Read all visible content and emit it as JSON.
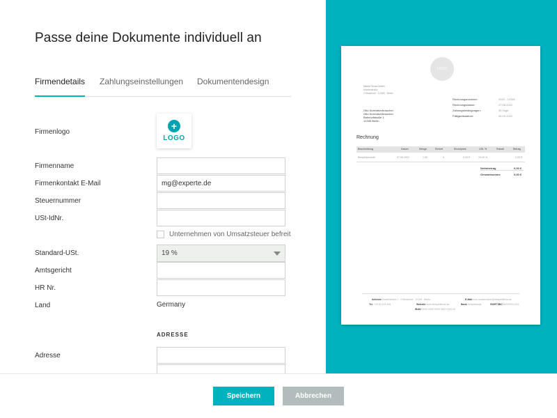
{
  "page": {
    "title": "Passe deine Dokumente individuell an"
  },
  "tabs": [
    {
      "label": "Firmendetails",
      "active": true
    },
    {
      "label": "Zahlungseinstellungen",
      "active": false
    },
    {
      "label": "Dokumentendesign",
      "active": false
    }
  ],
  "form": {
    "logo_label": "Firmenlogo",
    "logo_button": "LOGO",
    "company_name_label": "Firmenname",
    "company_name_value": "",
    "email_label": "Firmenkontakt E-Mail",
    "email_value": "mg@experte.de",
    "tax_number_label": "Steuernummer",
    "tax_number_value": "",
    "vat_id_label": "USt-IdNr.",
    "vat_id_value": "",
    "vat_exempt_label": "Unternehmen von Umsatzsteuer befreit",
    "vat_exempt_checked": false,
    "standard_vat_label": "Standard-USt.",
    "standard_vat_value": "19 %",
    "court_label": "Amtsgericht",
    "court_value": "",
    "hr_label": "HR Nr.",
    "hr_value": "",
    "country_label": "Land",
    "country_value": "Germany",
    "address_section": "ADRESSE",
    "address_label": "Adresse",
    "address_value": ""
  },
  "preview": {
    "logo_text": "LOGO",
    "sender_name": "Meine Firma GmbH",
    "sender_line2": "Musterstraße",
    "sender_line3": "0 Musterort · 12345 · Berlin",
    "recipient_lines": [
      "Otto Normalverbraucher",
      "Otto Normalverbraucher",
      "Bahnhofstraße 1",
      "12345 Berlin"
    ],
    "meta": [
      {
        "label": "Rechnungsnummer:",
        "value": "2022 - 12345"
      },
      {
        "label": "Rechnungsdatum:",
        "value": "27.08.2022"
      },
      {
        "label": "Zahlungsbedingungen:",
        "value": "30 Tage"
      },
      {
        "label": "Fälligkeitsdatum:",
        "value": "26.09.2022"
      }
    ],
    "heading": "Rechnung",
    "table_headers": [
      "Beschreibung",
      "Datum",
      "Menge",
      "Einheit",
      "Einzelpreis",
      "USt. %",
      "Rabatt",
      "Betrag"
    ],
    "table_row": [
      "Beispielprodukt",
      "27.08.2022",
      "1,00",
      "h",
      "0,00 €",
      "19,00 %",
      "",
      "0,00 €"
    ],
    "net_label": "Nettobetrag",
    "net_value": "0,00 €",
    "total_label": "Gesamtsumme",
    "total_value": "0,00 €",
    "footer_line1_label": "Adresse",
    "footer_line1_value": "Musterstraße 1 · 0 Musterort · 12345 · Berlin",
    "footer_email_label": "E-Mail",
    "footer_email_value": "max.mustermann@beispielfirma.de",
    "footer_tel_label": "Tel.",
    "footer_tel_value": "+49 30 123 456",
    "footer_web_label": "Website",
    "footer_web_value": "www.beispielfirma.de",
    "footer_bank_label": "Bank",
    "footer_bank_value": "Beispielbank",
    "footer_swift_label": "SWIFT/BIC",
    "footer_swift_value": "BEISPIELXXX",
    "footer_iban_label": "IBAN",
    "footer_iban_value": "DE00 0000 0000 0000 0000 00"
  },
  "footer": {
    "save_label": "Speichern",
    "cancel_label": "Abbrechen"
  },
  "colors": {
    "accent": "#00b1be",
    "secondary_button": "#b2bcbc"
  }
}
